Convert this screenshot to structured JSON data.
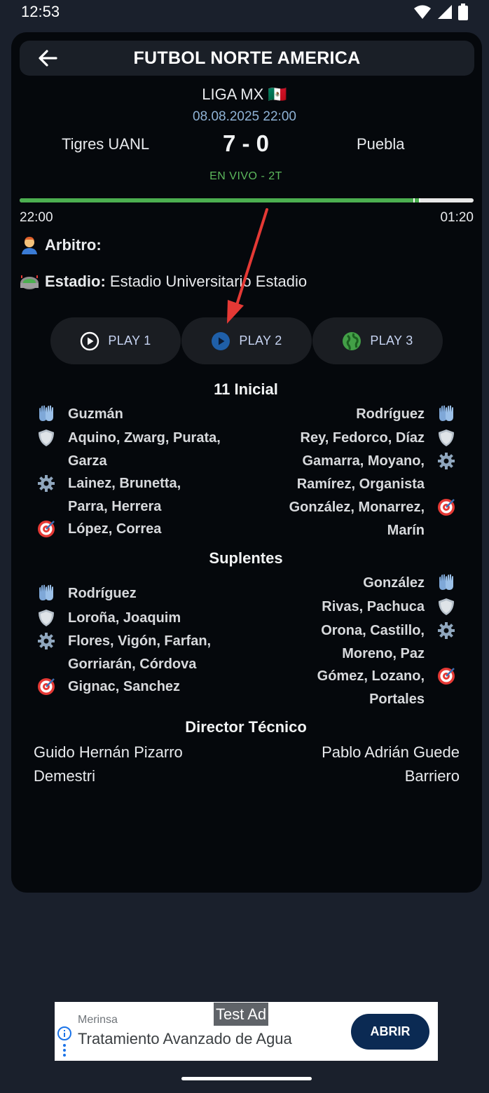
{
  "status_bar": {
    "time": "12:53"
  },
  "header": {
    "title": "FUTBOL NORTE AMERICA"
  },
  "match": {
    "league": "LIGA MX 🇲🇽",
    "date": "08.08.2025 22:00",
    "home_team": "Tigres UANL",
    "away_team": "Puebla",
    "score": "7 - 0",
    "status": "EN VIVO - 2T",
    "progress_fraction": 0.88,
    "time_start": "22:00",
    "time_end": "01:20"
  },
  "info": {
    "referee_label": "Arbitro:",
    "stadium_label": "Estadio:",
    "stadium_value": " Estadio Universitario Estadio"
  },
  "play_buttons": [
    {
      "label": "PLAY 1",
      "icon": "play-circle-outline-icon"
    },
    {
      "label": "PLAY 2",
      "icon": "play-circle-filled-icon"
    },
    {
      "label": "PLAY 3",
      "icon": "globe-icon"
    }
  ],
  "lineups": {
    "starting_title": "11 Inicial",
    "subs_title": "Suplentes",
    "coach_title": "Director Técnico",
    "home_starting": [
      {
        "icon": "goalkeeper-gloves-icon",
        "lines": [
          "Guzmán"
        ]
      },
      {
        "icon": "defender-shield-icon",
        "lines": [
          "Aquino, Zwarg, Purata,",
          "Garza"
        ]
      },
      {
        "icon": "midfielder-gear-icon",
        "lines": [
          "Lainez, Brunetta,",
          "Parra, Herrera"
        ]
      },
      {
        "icon": "forward-target-icon",
        "lines": [
          "López, Correa"
        ]
      }
    ],
    "away_starting": [
      {
        "icon": "goalkeeper-gloves-icon",
        "lines": [
          "Rodríguez"
        ]
      },
      {
        "icon": "defender-shield-icon",
        "lines": [
          "Rey, Fedorco, Díaz"
        ]
      },
      {
        "icon": "midfielder-gear-icon",
        "lines": [
          "Gamarra, Moyano,",
          "Ramírez, Organista"
        ]
      },
      {
        "icon": "forward-target-icon",
        "lines": [
          "González, Monarrez,",
          "Marín"
        ]
      }
    ],
    "home_subs": [
      {
        "icon": "goalkeeper-gloves-icon",
        "lines": [
          "Rodríguez"
        ]
      },
      {
        "icon": "defender-shield-icon",
        "lines": [
          "Loroña, Joaquim"
        ]
      },
      {
        "icon": "midfielder-gear-icon",
        "lines": [
          "Flores, Vigón, Farfan,",
          "Gorriarán, Córdova"
        ]
      },
      {
        "icon": "forward-target-icon",
        "lines": [
          "Gignac, Sanchez"
        ]
      }
    ],
    "away_subs": [
      {
        "icon": "goalkeeper-gloves-icon",
        "lines": [
          "González"
        ]
      },
      {
        "icon": "defender-shield-icon",
        "lines": [
          "Rivas, Pachuca"
        ]
      },
      {
        "icon": "midfielder-gear-icon",
        "lines": [
          "Orona, Castillo,",
          "Moreno, Paz"
        ]
      },
      {
        "icon": "forward-target-icon",
        "lines": [
          "Gómez, Lozano,",
          "Portales"
        ]
      }
    ],
    "home_coach": [
      "Guido Hernán Pizarro",
      "Demestri"
    ],
    "away_coach": [
      "Pablo Adrián Guede",
      "Barriero"
    ]
  },
  "ad": {
    "tag": "Test Ad",
    "brand": "Merinsa",
    "text": "Tratamiento Avanzado de Agua",
    "cta": "ABRIR"
  },
  "colors": {
    "background": "#1a202c",
    "card": "#05080c",
    "accent_green": "#4caf50",
    "live_text": "#5cb85c",
    "date_text": "#8fb3d6",
    "annotation_arrow": "#e53935"
  }
}
